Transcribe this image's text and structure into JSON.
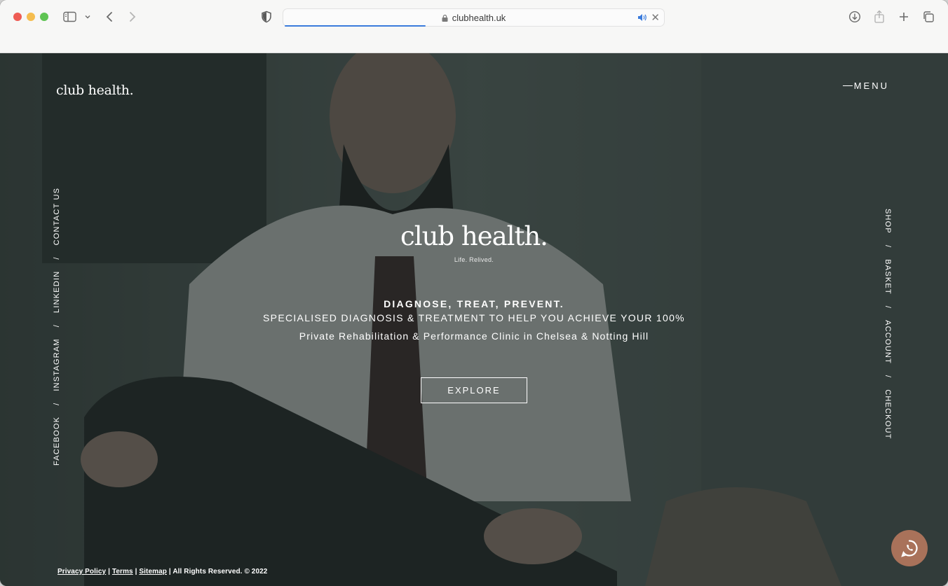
{
  "browser": {
    "url": "clubhealth.uk"
  },
  "header": {
    "logo": "club health.",
    "menu_label": "MENU"
  },
  "social_nav": {
    "items": [
      "FACEBOOK",
      "INSTAGRAM",
      "LINKEDIN",
      "CONTACT US"
    ],
    "separator": "/"
  },
  "shop_nav": {
    "items": [
      "SHOP",
      "BASKET",
      "ACCOUNT",
      "CHECKOUT"
    ],
    "separator": "/"
  },
  "hero": {
    "logo": "club health.",
    "tagline": "Life. Relived.",
    "headline": "DIAGNOSE, TREAT, PREVENT.",
    "subheadline": "SPECIALISED DIAGNOSIS & TREATMENT TO HELP YOU ACHIEVE YOUR 100%",
    "description": "Private Rehabilitation & Performance Clinic in Chelsea & Notting Hill",
    "cta_label": "EXPLORE"
  },
  "footer": {
    "privacy": "Privacy Policy",
    "terms": "Terms",
    "sitemap": "Sitemap",
    "sep": "|",
    "rights": "All Rights Reserved. © 2022"
  },
  "colors": {
    "overlay": "#1c2422",
    "whatsapp_button": "#a9725a",
    "url_progress": "#3a7bdc"
  }
}
